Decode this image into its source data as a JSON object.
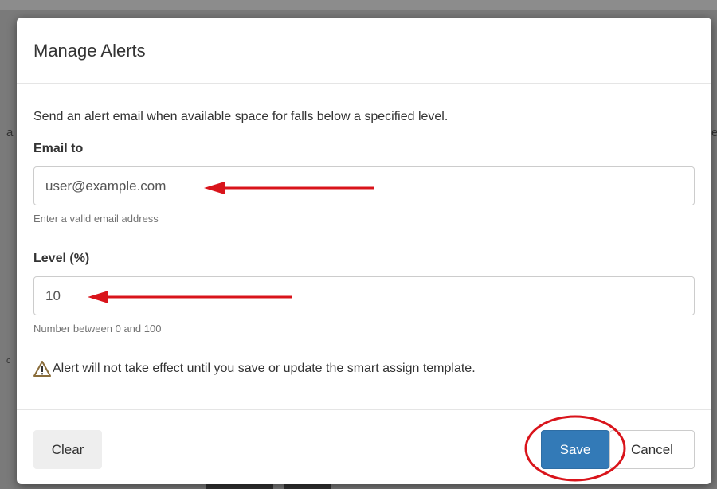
{
  "modal": {
    "title": "Manage Alerts",
    "description": "Send an alert email when available space for falls below a specified level.",
    "email": {
      "label": "Email to",
      "value": "user@example.com",
      "help": "Enter a valid email address"
    },
    "level": {
      "label": "Level (%)",
      "value": "10",
      "help": "Number between 0 and 100"
    },
    "warning": {
      "icon": "warning-triangle-icon",
      "text": "Alert will not take effect until you save or update the smart assign template."
    },
    "footer": {
      "clear_label": "Clear",
      "save_label": "Save",
      "cancel_label": "Cancel"
    }
  },
  "colors": {
    "primary": "#337ab7",
    "annotation_red": "#d9141b",
    "warning_icon": "#8a6d3b"
  }
}
